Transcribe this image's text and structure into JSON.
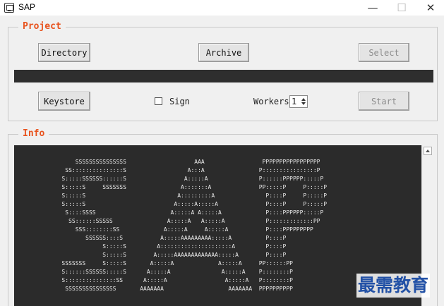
{
  "window": {
    "title": "SAP",
    "minimize_glyph": "—",
    "maximize_glyph": "☐",
    "close_glyph": "✕",
    "icon": "app-window-icon"
  },
  "project": {
    "legend": "Project",
    "directory_label": "Directory",
    "archive_label": "Archive",
    "select_label": "Select",
    "keystore_label": "Keystore",
    "sign_label": "Sign",
    "sign_checked": false,
    "workers_label": "Workers:",
    "workers_value": "1",
    "start_label": "Start",
    "path_value": ""
  },
  "info": {
    "legend": "Info",
    "ascii_art": "                  SSSSSSSSSSSSSSS                    AAA                 PPPPPPPPPPPPPPPPP\n               SS:::::::::::::::S                  A:::A                P::::::::::::::::P\n              S:::::SSSSSS::::::S                 A:::::A               P::::::PPPPPP:::::P\n              S:::::S     SSSSSSS                A:::::::A              PP:::::P     P:::::P\n              S:::::S                           A:::::::::A               P::::P     P:::::P\n              S:::::S                          A:::::A:::::A              P::::P     P:::::P\n               S::::SSSS                      A:::::A A:::::A             P::::PPPPPP:::::P\n                SS::::::SSSSS                A:::::A   A:::::A            P:::::::::::::PP\n                  SSS::::::::SS             A:::::A     A:::::A           P::::PPPPPPPPP\n                     SSSSSS::::S           A:::::AAAAAAAAA:::::A          P::::P\n                          S:::::S         A:::::::::::::::::::::A         P::::P\n                          S:::::S        A:::::AAAAAAAAAAAAA:::::A        P::::P\n              SSSSSSS     S:::::S       A:::::A             A:::::A     PP::::::PP\n              S::::::SSSSSS:::::S      A:::::A               A:::::A    P::::::::P\n              S:::::::::::::::SS      A:::::A                 A:::::A   P::::::::P\n               SSSSSSSSSSSSSSS       AAAAAAA                   AAAAAAA  PPPPPPPPPP"
  },
  "watermark": {
    "text": "最需教育"
  },
  "colors": {
    "legend": "#e8531e",
    "console_bg": "#2b2b2b",
    "console_fg": "#e8e8e8",
    "watermark": "#2251a6"
  }
}
